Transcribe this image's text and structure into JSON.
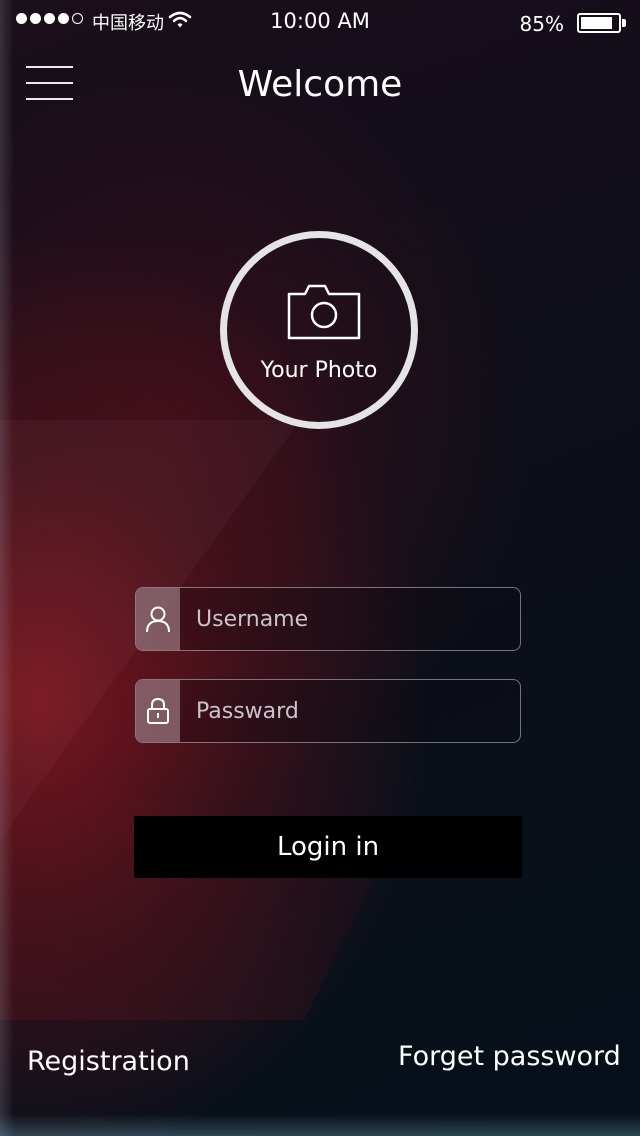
{
  "status_bar": {
    "carrier": "中国移动",
    "time": "10:00 AM",
    "battery_percent": "85%",
    "battery_level": 0.85,
    "signal_bars": 4,
    "signal_total": 5
  },
  "header": {
    "title": "Welcome"
  },
  "photo": {
    "label": "Your Photo"
  },
  "form": {
    "username_placeholder": "Username",
    "password_placeholder": "Passward",
    "login_label": "Login in"
  },
  "footer": {
    "registration_label": "Registration",
    "forget_password_label": "Forget password"
  },
  "icons": [
    "menu-icon",
    "camera-icon",
    "user-icon",
    "lock-icon",
    "wifi-icon",
    "battery-icon"
  ],
  "colors": {
    "accent_red": "#8c161e",
    "button_bg": "#000000",
    "field_icon_bg": "#aa8c94"
  }
}
